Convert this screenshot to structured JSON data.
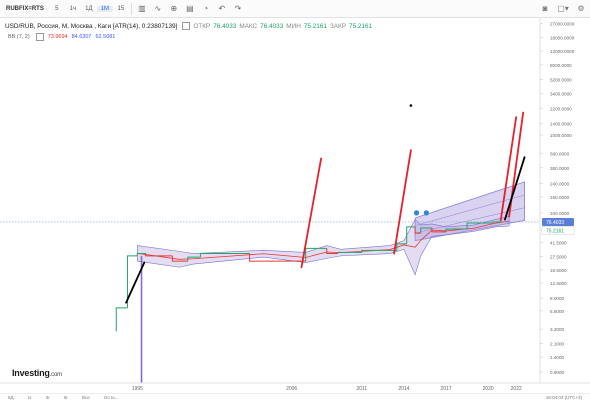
{
  "toolbar": {
    "symbol": "RUBFIX=RTS",
    "timeframes": [
      "5",
      "1ч",
      "1Д",
      "1М",
      "15"
    ],
    "active_timeframe_index": 3
  },
  "legend": {
    "title": "USD/RUB, Россия, М, Москва , Каги [ATR(14), 0.23807139]",
    "open_label": "ОТКР",
    "open_value": "76.4033",
    "high_label": "МАКС",
    "high_value": "76.4033",
    "low_label": "МИН",
    "low_value": "75.2161",
    "close_label": "ЗАКР",
    "close_value": "75.2161"
  },
  "indicator": {
    "label": "BB (7, 2)",
    "v1": "73.9694",
    "v2": "84.6307",
    "v3": "62.5081"
  },
  "logo": {
    "brand": "Investing",
    "suffix": ".com"
  },
  "bottombar": {
    "items": [
      "5Д",
      "1г",
      "3г",
      "5г",
      "Все",
      "Go to..."
    ],
    "right": "16:04:03 (UTC+3)"
  },
  "colors": {
    "up": "#26a269",
    "down": "#e53935",
    "band_fill": "#b39ddb",
    "channel_fill": "#ab9ee0",
    "price_line": "#5f8fd6",
    "red_line": "#e8202a",
    "black_line": "#000000"
  },
  "chart_data": {
    "type": "line",
    "y_scale": "log",
    "y_ticks": [
      "27000.0000",
      "18000.0000",
      "12000.0000",
      "8000.0000",
      "5200.0000",
      "3400.0000",
      "2200.0000",
      "1400.0000",
      "1000.0000",
      "580.0000",
      "380.0000",
      "240.0000",
      "160.0000",
      "100.0000",
      "60.0000",
      "41.5000",
      "27.5000",
      "18.5000",
      "12.5000",
      "8.0000",
      "5.5000",
      "3.2000",
      "2.1000",
      "1.4000",
      "0.9000"
    ],
    "x_ticks": [
      "1995",
      "2006",
      "2011",
      "2014",
      "2017",
      "2020",
      "2022"
    ],
    "last_price": "76.4033",
    "close_price": "75.2161",
    "series": [
      {
        "x": [
          1993.5,
          1994.3,
          1995.0,
          1995.6,
          1997.5,
          1998.6,
          1999.5,
          2003.0,
          2007.0,
          2008.5,
          2009.3,
          2011.0,
          2013.5,
          2014.2,
          2014.8,
          2015.2,
          2016.0,
          2017.0,
          2018.5,
          2020.3,
          2021.0
        ],
        "y": [
          3.0,
          6.0,
          28.0,
          30.0,
          28.0,
          24.0,
          27.0,
          30.0,
          24.0,
          35.0,
          30.0,
          31.0,
          33.0,
          40.0,
          66.0,
          55.0,
          64.0,
          57.0,
          62.0,
          74.0,
          76.4
        ]
      }
    ],
    "band": {
      "x": [
        1995,
        1998,
        1999,
        2004,
        2007,
        2008.5,
        2009.5,
        2013,
        2014,
        2014.8,
        2015.2,
        2016,
        2017,
        2019,
        2020.5,
        2021.5
      ],
      "upper": [
        38,
        32,
        30,
        33,
        31,
        38,
        34,
        38,
        44,
        82,
        70,
        72,
        66,
        70,
        82,
        90
      ],
      "lower": [
        24,
        20,
        22,
        27,
        23,
        26,
        28,
        30,
        34,
        16,
        28,
        50,
        52,
        58,
        66,
        68
      ]
    },
    "channel": {
      "x": [
        2014.8,
        2022.6
      ],
      "upper": [
        86,
        250
      ],
      "lower": [
        44,
        80
      ]
    },
    "annotations": [
      {
        "type": "line",
        "x": [
          1994.2,
          1995.5
        ],
        "y": [
          7.0,
          23.0
        ],
        "color": "black"
      },
      {
        "type": "line",
        "x": [
          2006.7,
          2008.1
        ],
        "y": [
          20.0,
          500.0
        ],
        "color": "red"
      },
      {
        "type": "line",
        "x": [
          2013.3,
          2014.5
        ],
        "y": [
          30.0,
          640.0
        ],
        "color": "red"
      },
      {
        "type": "line",
        "x": [
          2020.9,
          2022.0
        ],
        "y": [
          80.0,
          1700.0
        ],
        "color": "red"
      },
      {
        "type": "line",
        "x": [
          2021.5,
          2022.5
        ],
        "y": [
          90.0,
          1950.0
        ],
        "color": "red"
      },
      {
        "type": "line",
        "x": [
          2021.2,
          2022.6
        ],
        "y": [
          82.0,
          520.0
        ],
        "color": "black"
      },
      {
        "type": "point",
        "x": 2014.5,
        "y": 2400.0,
        "color": "black"
      }
    ]
  }
}
